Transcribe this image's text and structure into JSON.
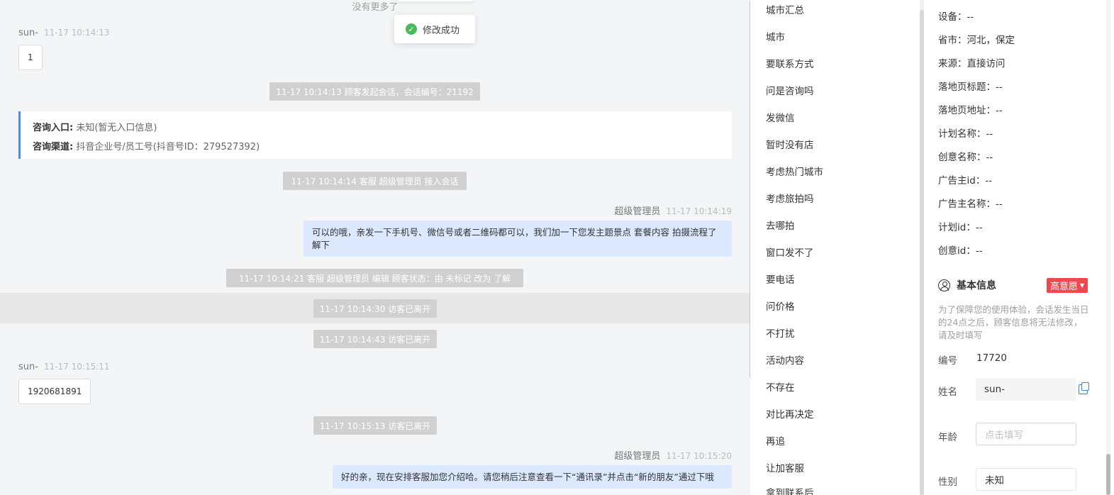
{
  "chat": {
    "no_more": "没有更多了",
    "toast": "修改成功",
    "m1": {
      "sender": "sun-",
      "time": "11-17 10:14:13",
      "text": "1"
    },
    "sys1": "11-17 10:14:13 顾客发起会话，会话编号：21192",
    "entry": {
      "label1": "咨询入口:",
      "value1": "未知(暂无入口信息)",
      "label2": "咨询渠道:",
      "value2": "抖音企业号/员工号(抖音号ID：279527392)"
    },
    "sys2": "11-17 10:14:14 客服 超级管理员 接入会话",
    "m2": {
      "sender": "超级管理员",
      "time": "11-17 10:14:19",
      "text": "可以的哦，亲发一下手机号、微信号或者二维码都可以，我们加一下您发主题景点 套餐内容 拍摄流程了解下"
    },
    "sys3": "11-17 10:14:21 客服 超级管理员 编辑 顾客状态：由 未标记 改为 了解",
    "sys4": "11-17 10:14:30 访客已离开",
    "sys5": "11-17 10:14:43 访客已离开",
    "m3": {
      "sender": "sun-",
      "time": "11-17 10:15:11",
      "text": "1920681891"
    },
    "sys6": "11-17 10:15:13 访客已离开",
    "m4": {
      "sender": "超级管理员",
      "time": "11-17 10:15:20",
      "text": "好的亲，现在安排客服加您介绍哈。请您稍后注意查看一下“通讯录”并点击“新的朋友”通过下哦"
    }
  },
  "replies": [
    "城市汇总",
    "城市",
    "要联系方式",
    "问是咨询吗",
    "发微信",
    "暂时没有店",
    "考虑热门城市",
    "考虑旅拍吗",
    "去哪拍",
    "窗口发不了",
    "要电话",
    "问价格",
    "不打扰",
    "活动内容",
    "不存在",
    "对比再决定",
    "再追",
    "让加客服",
    "拿到联系后"
  ],
  "info": {
    "rows": [
      "设备：--",
      "省市：河北，保定",
      "来源：直接访问",
      "落地页标题：--",
      "落地页地址：--",
      "计划名称：--",
      "创意名称：--",
      "广告主id：--",
      "广告主名称：--",
      "计划id：--",
      "创意id：--"
    ],
    "basic_title": "基本信息",
    "badge": "高意愿",
    "notice": "为了保障您的使用体验，会话发生当日的24点之后，顾客信息将无法修改，请及时填写",
    "id_label": "编号",
    "id_value": "17720",
    "name_label": "姓名",
    "name_value": "sun-",
    "age_label": "年龄",
    "age_placeholder": "点击填写",
    "gender_label": "性别",
    "gender_value": "未知"
  }
}
